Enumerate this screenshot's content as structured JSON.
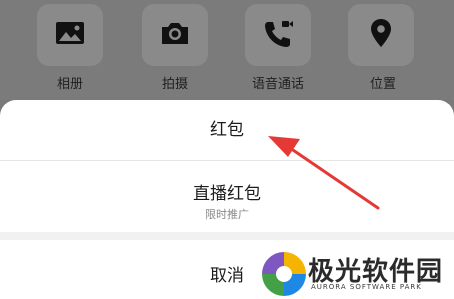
{
  "toolbar": {
    "items": [
      {
        "label": "相册",
        "icon": "image-icon"
      },
      {
        "label": "拍摄",
        "icon": "camera-icon"
      },
      {
        "label": "语音通话",
        "icon": "phone-call-icon"
      },
      {
        "label": "位置",
        "icon": "location-pin-icon"
      }
    ]
  },
  "sheet": {
    "red_packet_label": "红包",
    "live_red_packet_label": "直播红包",
    "live_red_packet_sub": "限时推广",
    "cancel_label": "取消"
  },
  "watermark": {
    "title": "极光软件园",
    "subtitle": "AURORA SOFTWARE PARK"
  },
  "colors": {
    "arrow": "#e53935",
    "overlay": "#7b7b7b",
    "sheet_bg": "#ffffff"
  }
}
